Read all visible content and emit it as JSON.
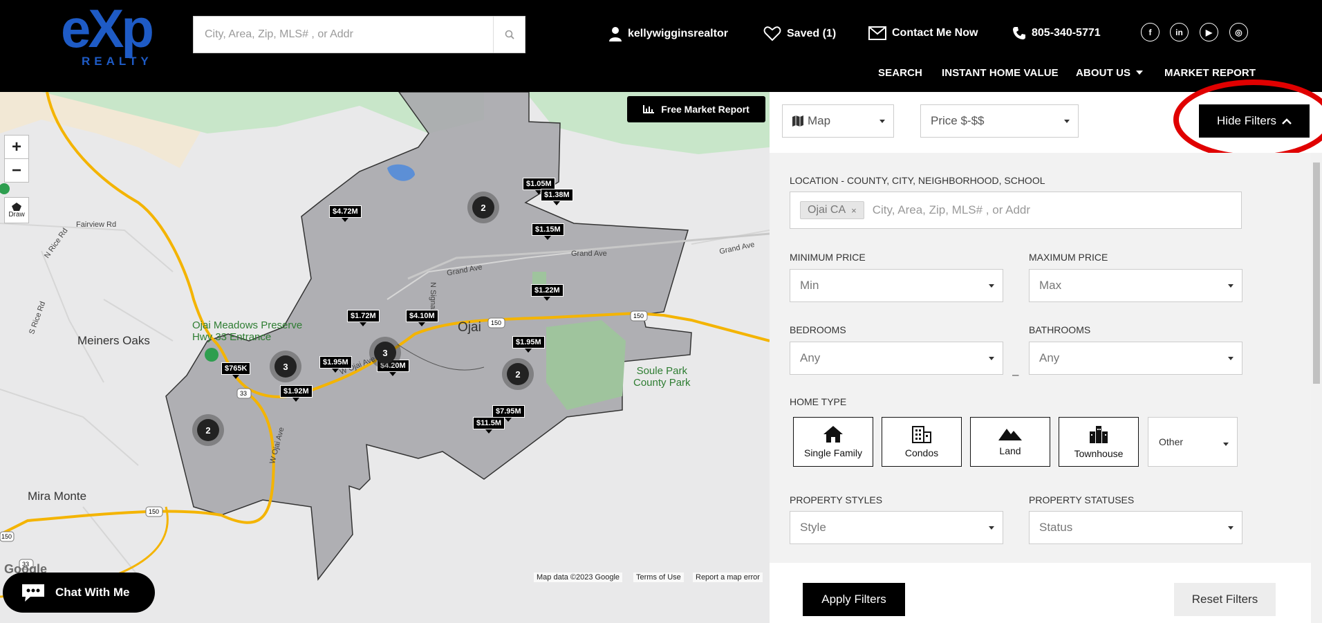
{
  "header": {
    "logo_text": "eXp",
    "logo_sub": "REALTY",
    "search_placeholder": "City, Area, Zip, MLS# , or Addr",
    "user": "kellywigginsrealtor",
    "saved": "Saved (1)",
    "contact": "Contact Me Now",
    "phone": "805-340-5771",
    "social": [
      "f",
      "in",
      "▶",
      "◎"
    ],
    "nav": [
      "SEARCH",
      "INSTANT HOME VALUE",
      "ABOUT US",
      "MARKET REPORT"
    ]
  },
  "map": {
    "free_market_report": "Free Market Report",
    "zoom_in": "+",
    "zoom_out": "−",
    "draw": "Draw",
    "city_labels": [
      "Ojai",
      "Meiners Oaks",
      "Mira Monte"
    ],
    "road_labels": [
      "Fairview Rd",
      "N Rice Rd",
      "S Rice Rd",
      "Grand Ave",
      "Grand Ave",
      "W Ojai Ave",
      "W Ojai Ave",
      "N Signal St"
    ],
    "park_labels": [
      "Ojai Meadows Preserve",
      "Hwy 33 Entrance",
      "Soule Park",
      "County Park"
    ],
    "highway_badges": [
      "150",
      "150",
      "33",
      "150",
      "33",
      "150"
    ],
    "price_pins": [
      "$1.05M",
      "$1.38M",
      "$4.72M",
      "$1.15M",
      "$1.22M",
      "$1.72M",
      "$4.10M",
      "$1.95M",
      "$765K",
      "$1.95M",
      "$4.20M",
      "$1.92M",
      "$7.95M",
      "$11.5M"
    ],
    "clusters": [
      "2",
      "3",
      "3",
      "2",
      "2"
    ],
    "footer": [
      "Map data ©2023 Google",
      "Terms of Use",
      "Report a map error"
    ],
    "google": "Google",
    "chat": "Chat With Me"
  },
  "panel": {
    "view_select": "Map",
    "price_select": "Price $-$$",
    "hide_filters": "Hide Filters",
    "location_label": "LOCATION - COUNTY, CITY, NEIGHBORHOOD, SCHOOL",
    "location_chip": "Ojai CA",
    "location_placeholder": "City, Area, Zip, MLS# , or Addr",
    "min_price_label": "MINIMUM PRICE",
    "min_price_value": "Min",
    "max_price_label": "MAXIMUM PRICE",
    "max_price_value": "Max",
    "range_dash": "–",
    "bedrooms_label": "BEDROOMS",
    "bedrooms_value": "Any",
    "bathrooms_label": "BATHROOMS",
    "bathrooms_value": "Any",
    "home_type_label": "HOME TYPE",
    "home_types": [
      "Single Family",
      "Condos",
      "Land",
      "Townhouse"
    ],
    "home_type_other": "Other",
    "styles_label": "PROPERTY STYLES",
    "styles_value": "Style",
    "statuses_label": "PROPERTY STATUSES",
    "statuses_value": "Status",
    "apply": "Apply Filters",
    "reset": "Reset Filters"
  },
  "colors": {
    "brand_blue": "#1e5bc6",
    "header_bg": "#000000",
    "highlight_ring": "#e00000",
    "boundary_fill": "#a9a9ad",
    "park_green": "#a8d5a2",
    "highway": "#f4b400"
  }
}
